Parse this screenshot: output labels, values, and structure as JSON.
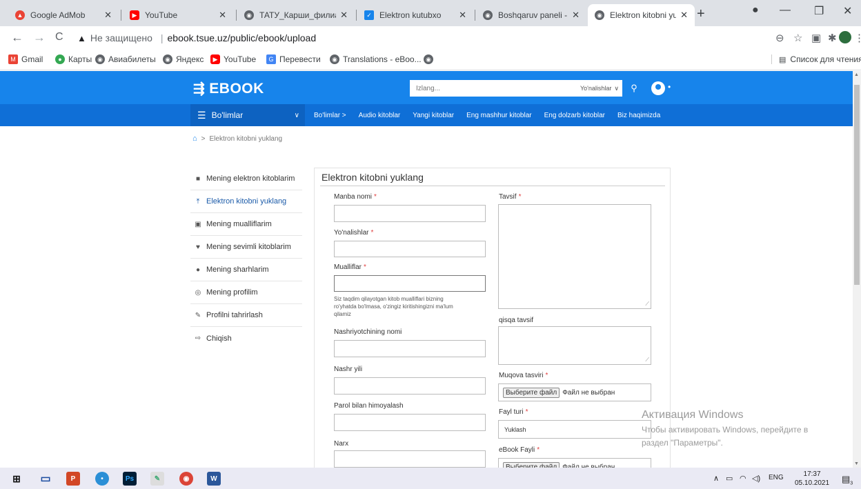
{
  "browser": {
    "tabs": [
      {
        "title": "Google AdMob",
        "icon": "admob-icon",
        "color": "#ea4335"
      },
      {
        "title": "YouTube",
        "icon": "youtube-icon",
        "color": "#ff0000"
      },
      {
        "title": "ТАТУ_Карши_филиал",
        "icon": "globe-icon",
        "color": "#5f6368"
      },
      {
        "title": "Elektron kutubxo",
        "icon": "site-icon",
        "color": "#1784eb"
      },
      {
        "title": "Boshqaruv paneli - eB",
        "icon": "globe-icon",
        "color": "#5f6368"
      },
      {
        "title": "Elektron kitobni yuklar",
        "icon": "globe-icon",
        "color": "#5f6368"
      }
    ],
    "insecure_label": "Не защищено",
    "url": "ebook.tsue.uz/public/ebook/upload",
    "bookmarks": [
      "Gmail",
      "Карты",
      "Авиабилеты",
      "Яндекс",
      "YouTube",
      "Перевести",
      "Translations - eBoo...",
      ""
    ],
    "reading_list": "Список для чтения"
  },
  "site": {
    "logo": "EBOOK",
    "search_placeholder": "Izlang...",
    "search_category": "Yo'nalishlar",
    "categories_button": "Bo'limlar",
    "nav_links": [
      "Bo'limlar >",
      "Audio kitoblar",
      "Yangi kitoblar",
      "Eng mashhur kitoblar",
      "Eng dolzarb kitoblar",
      "Biz haqimizda"
    ],
    "breadcrumb": "Elektron kitobni yuklang"
  },
  "sidebar": {
    "items": [
      {
        "label": "Mening elektron kitoblarim",
        "icon": "book-icon"
      },
      {
        "label": "Elektron kitobni yuklang",
        "icon": "upload-icon",
        "active": true
      },
      {
        "label": "Mening mualliflarim",
        "icon": "author-icon"
      },
      {
        "label": "Mening sevimli kitoblarim",
        "icon": "heart-icon"
      },
      {
        "label": "Mening sharhlarim",
        "icon": "comment-icon"
      },
      {
        "label": "Mening profilim",
        "icon": "profile-icon"
      },
      {
        "label": "Profilni tahrirlash",
        "icon": "edit-icon"
      },
      {
        "label": "Chiqish",
        "icon": "logout-icon"
      }
    ]
  },
  "form": {
    "title": "Elektron kitobni yuklang",
    "source_name": "Manba nomi",
    "directions": "Yo'nalishlar",
    "authors": "Mualliflar",
    "authors_help": [
      "Siz taqdim qilayotgan kitob mualliflari bizning",
      "ro'yhatda bo'lmasa, o'zingiz kiritishingizni ma'lum",
      "qilamiz"
    ],
    "publisher": "Nashriyotchining nomi",
    "publish_year": "Nashr yili",
    "password": "Parol bilan himoyalash",
    "price": "Narx",
    "description": "Tavsif",
    "short_description": "qisqa tavsif",
    "cover": "Muqova tasviri",
    "file_button": "Выберите файл",
    "no_file": "Файл не выбран",
    "file_type": "Fayl turi",
    "file_type_value": "Yuklash",
    "ebook_file": "eBook Fayli",
    "required_mark": "*"
  },
  "watermark": {
    "title": "Активация Windows",
    "line1": "Чтобы активировать Windows, перейдите в",
    "line2": "раздел \"Параметры\"."
  },
  "taskbar": {
    "lang": "ENG",
    "time": "17:37",
    "date": "05.10.2021",
    "notif_count": "3"
  },
  "colors": {
    "header_blue": "#1784eb",
    "nav_blue": "#0f6fd7",
    "active_link": "#1a5aa8",
    "required": "#e04040"
  }
}
